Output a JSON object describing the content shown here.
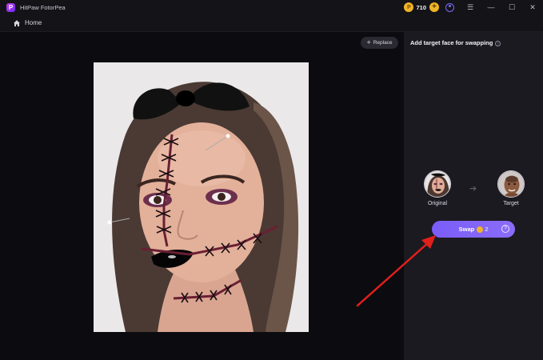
{
  "app": {
    "title": "HitPaw FotorPea",
    "logo_letter": "P"
  },
  "titlebar": {
    "coin_symbol": "P",
    "coin_count": "710",
    "add_symbol": "+",
    "menu_symbol": "☰",
    "minimize_symbol": "—",
    "maximize_symbol": "☐",
    "close_symbol": "✕"
  },
  "nav": {
    "home_label": "Home"
  },
  "canvas": {
    "replace_label": "Replace",
    "replace_symbol": "+"
  },
  "panel": {
    "title": "Add target face for swapping",
    "info_symbol": "i",
    "original_label": "Original",
    "target_label": "Target",
    "arrow_symbol": "➔",
    "swap_label": "Swap",
    "swap_cost": "2",
    "swap_help_symbol": "?"
  },
  "colors": {
    "accent": "#7a5df8",
    "coin": "#f0b429",
    "annotation_arrow": "#e0201b"
  }
}
